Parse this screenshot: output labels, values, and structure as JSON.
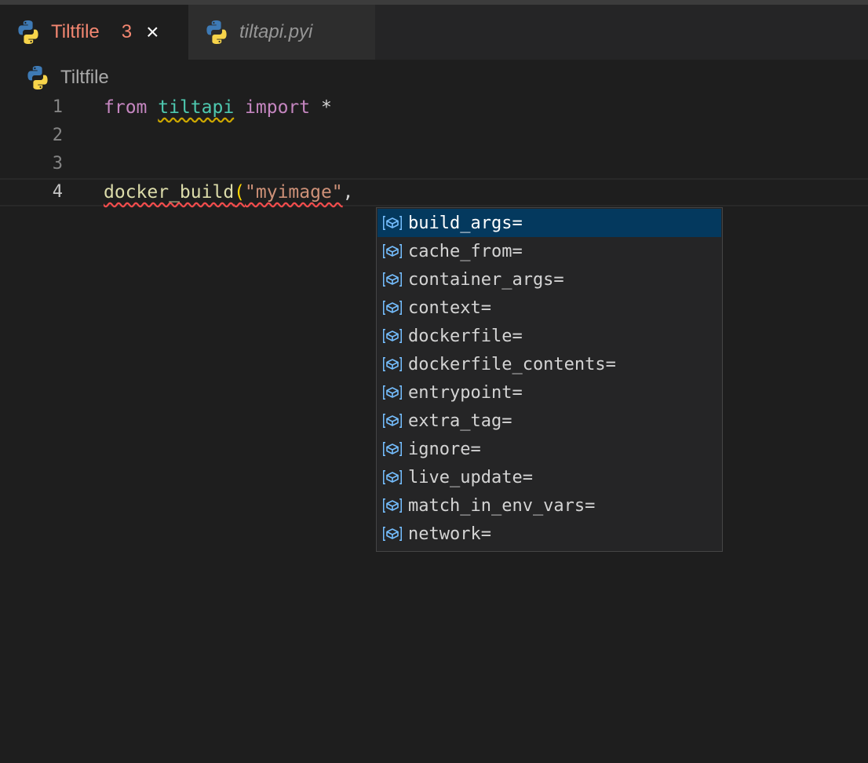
{
  "tabs": [
    {
      "label": "Tiltfile",
      "badge": "3",
      "close": "×",
      "active": true
    },
    {
      "label": "tiltapi.pyi",
      "active": false
    }
  ],
  "breadcrumb": {
    "label": "Tiltfile"
  },
  "editor": {
    "lines": [
      {
        "number": "1",
        "tokens": [
          "from",
          " ",
          "tiltapi",
          " ",
          "import",
          " *"
        ]
      },
      {
        "number": "2",
        "tokens": []
      },
      {
        "number": "3",
        "tokens": []
      },
      {
        "number": "4",
        "tokens": [
          "docker_build",
          "(",
          "\"myimage\"",
          ","
        ]
      }
    ]
  },
  "suggestions": {
    "icon": "variable-icon",
    "selected_index": 0,
    "items": [
      "build_args=",
      "cache_from=",
      "container_args=",
      "context=",
      "dockerfile=",
      "dockerfile_contents=",
      "entrypoint=",
      "extra_tag=",
      "ignore=",
      "live_update=",
      "match_in_env_vars=",
      "network="
    ]
  },
  "colors": {
    "keyword": "#c586c0",
    "module": "#4ec9b0",
    "function": "#dcdcaa",
    "string": "#ce9178",
    "error_tab": "#f48771",
    "selection": "#04395e"
  }
}
